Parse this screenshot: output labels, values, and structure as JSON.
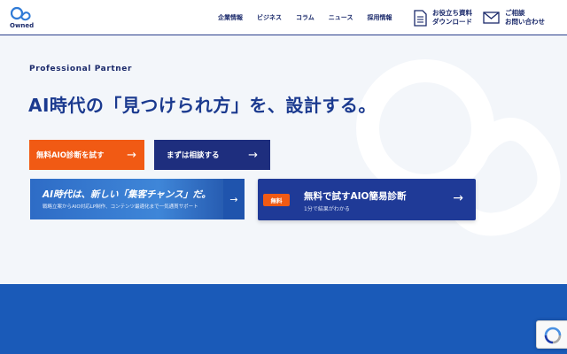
{
  "header": {
    "logo_text": "Owned",
    "nav": [
      "企業情報",
      "ビジネス",
      "コラム",
      "ニュース",
      "採用情報"
    ],
    "download": {
      "line1": "お役立ち資料",
      "line2": "ダウンロード"
    },
    "contact": {
      "line1": "ご相談",
      "line2": "お問い合わせ"
    }
  },
  "hero": {
    "eyebrow": "Professional Partner",
    "headline": "AI時代の「見つけられ方」を、設計する。"
  },
  "buttons": {
    "free_diagnosis": "無料AIO診断を試す",
    "consult": "まずは相談する",
    "arrow": "→"
  },
  "banner_left": {
    "title": "AI時代は、新しい「集客チャンス」だ。",
    "subtitle": "戦略立案からAIO対応LP制作、コンテンツ最適化まで一気通貫サポート",
    "arrow": "→"
  },
  "banner_right": {
    "badge": "無料",
    "title": "無料で試すAIO簡易診断",
    "subtitle": "1分で結果がわかる",
    "arrow": "→"
  },
  "colors": {
    "navy": "#1e2e7e",
    "orange": "#f15a14",
    "blue_band": "#1a5ab8",
    "background": "#f3f6fa"
  },
  "icons": {
    "download": "document-icon",
    "contact": "mail-icon",
    "recaptcha": "recaptcha-icon"
  }
}
